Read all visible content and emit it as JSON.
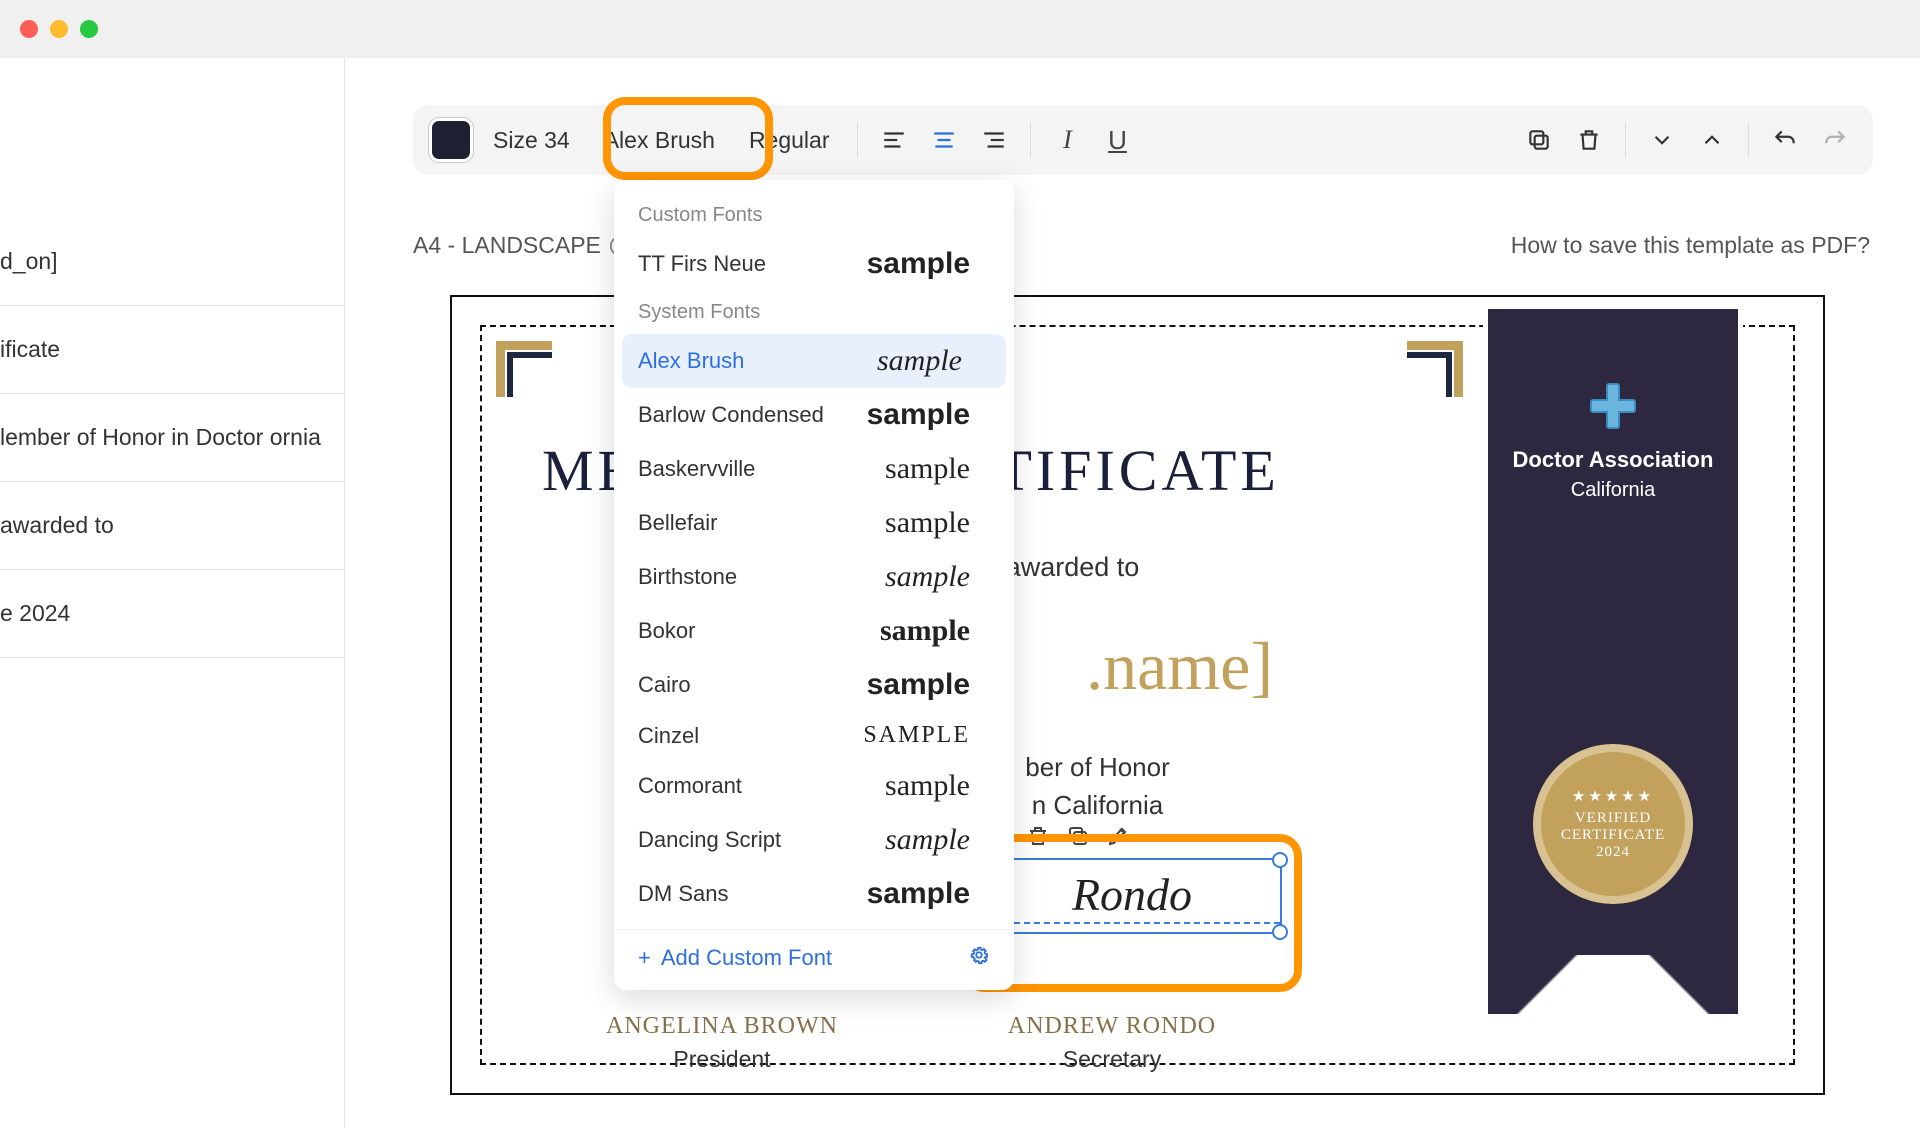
{
  "window": {
    "os": "mac"
  },
  "toolbar": {
    "color": "#1e2132",
    "size_label": "Size 34",
    "font_label": "Alex Brush",
    "weight_label": "Regular"
  },
  "doc": {
    "format_label": "A4 - LANDSCAPE",
    "help_link": "How to save this template as PDF?"
  },
  "sidebar": {
    "items": [
      {
        "label": "d_on]"
      },
      {
        "label": "ificate"
      },
      {
        "label": "lember of Honor in Doctor ornia"
      },
      {
        "label": "awarded to"
      },
      {
        "label": "e 2024"
      }
    ]
  },
  "certificate": {
    "title_left": "ME",
    "title_right": "CERTIFICATE",
    "award_fragment": "awarded to",
    "name_fragment": ".name]",
    "sub1_fragment": "ber of Honor",
    "sub2_fragment": "n California",
    "sig_left_name": "Angelina Brown",
    "sig_left_title": "President",
    "sig_right_name": "Andrew Rondo",
    "sig_right_title": "Secretary",
    "banner_line1": "Doctor Association",
    "banner_line2": "California",
    "seal_line1": "VERIFIED",
    "seal_line2": "CERTIFICATE",
    "seal_year": "2024",
    "selected_text": "Rondo"
  },
  "font_dropdown": {
    "section_custom": "Custom Fonts",
    "section_system": "System Fonts",
    "custom": [
      {
        "name": "TT Firs Neue",
        "sample": "sample",
        "style": "sans"
      }
    ],
    "system": [
      {
        "name": "Alex Brush",
        "sample": "sample",
        "style": "script",
        "selected": true
      },
      {
        "name": "Barlow Condensed",
        "sample": "sample",
        "style": "cond"
      },
      {
        "name": "Baskervville",
        "sample": "sample",
        "style": "serif"
      },
      {
        "name": "Bellefair",
        "sample": "sample",
        "style": "serif"
      },
      {
        "name": "Birthstone",
        "sample": "sample",
        "style": "script"
      },
      {
        "name": "Bokor",
        "sample": "sample",
        "style": "black"
      },
      {
        "name": "Cairo",
        "sample": "sample",
        "style": "sans"
      },
      {
        "name": "Cinzel",
        "sample": "SAMPLE",
        "style": "small"
      },
      {
        "name": "Cormorant",
        "sample": "sample",
        "style": "serif"
      },
      {
        "name": "Dancing Script",
        "sample": "sample",
        "style": "script"
      },
      {
        "name": "DM Sans",
        "sample": "sample",
        "style": "sans"
      }
    ],
    "add_label": "Add Custom Font"
  }
}
